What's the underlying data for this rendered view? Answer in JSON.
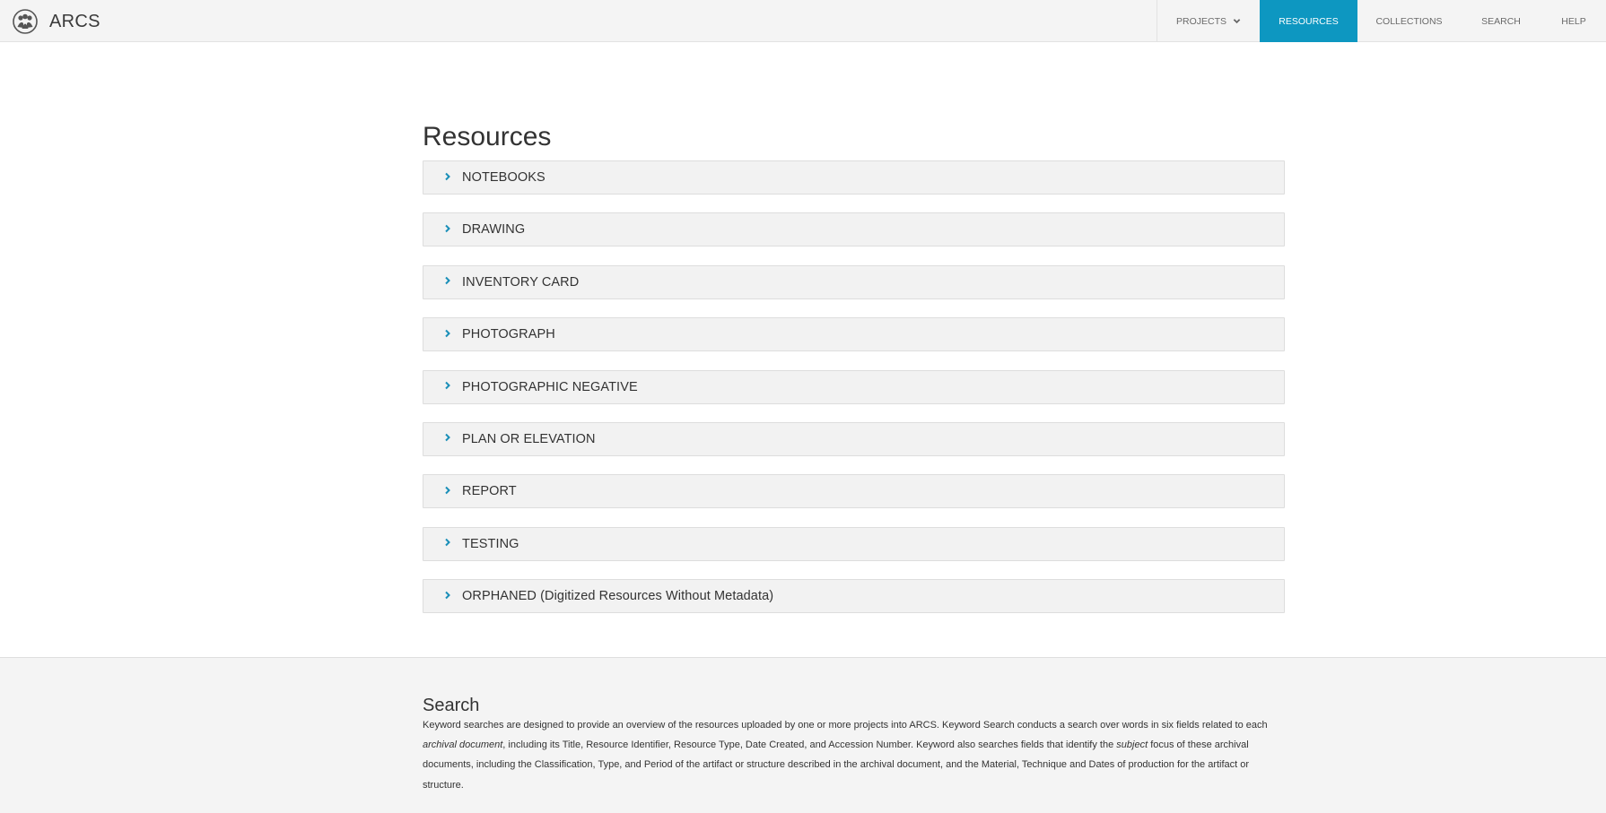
{
  "app": {
    "name": "ARCS"
  },
  "nav": {
    "projects": "PROJECTS",
    "resources": "RESOURCES",
    "collections": "COLLECTIONS",
    "search": "SEARCH",
    "help": "HELP"
  },
  "main": {
    "title": "Resources",
    "panels": [
      "NOTEBOOKS",
      "DRAWING",
      "INVENTORY CARD",
      "PHOTOGRAPH",
      "PHOTOGRAPHIC NEGATIVE",
      "PLAN OR ELEVATION",
      "REPORT",
      "TESTING",
      "ORPHANED (Digitized Resources Without Metadata)"
    ]
  },
  "search_section": {
    "title": "Search",
    "text_1": "Keyword searches are designed to provide an overview of the resources uploaded by one or more projects into ARCS. Keyword Search conducts a search over words in six fields related to each ",
    "em_1": "archival document",
    "text_2": ", including its Title, Resource Identifier, Resource Type, Date Created, and Accession Number. Keyword also searches fields that identify the ",
    "em_2": "subject",
    "text_3": " focus of these archival documents, including the Classification, Type, and Period of the artifact or structure described in the archival document, and the Material, Technique and Dates of production for the artifact or structure."
  },
  "colors": {
    "accent": "#0d97c1",
    "header_bg": "#f4f4f4",
    "panel_bg": "#f2f2f2"
  },
  "icons": {
    "logo": "arcs-people-logo",
    "dropdown": "chevron-down-icon",
    "panel": "chevron-right-icon"
  }
}
